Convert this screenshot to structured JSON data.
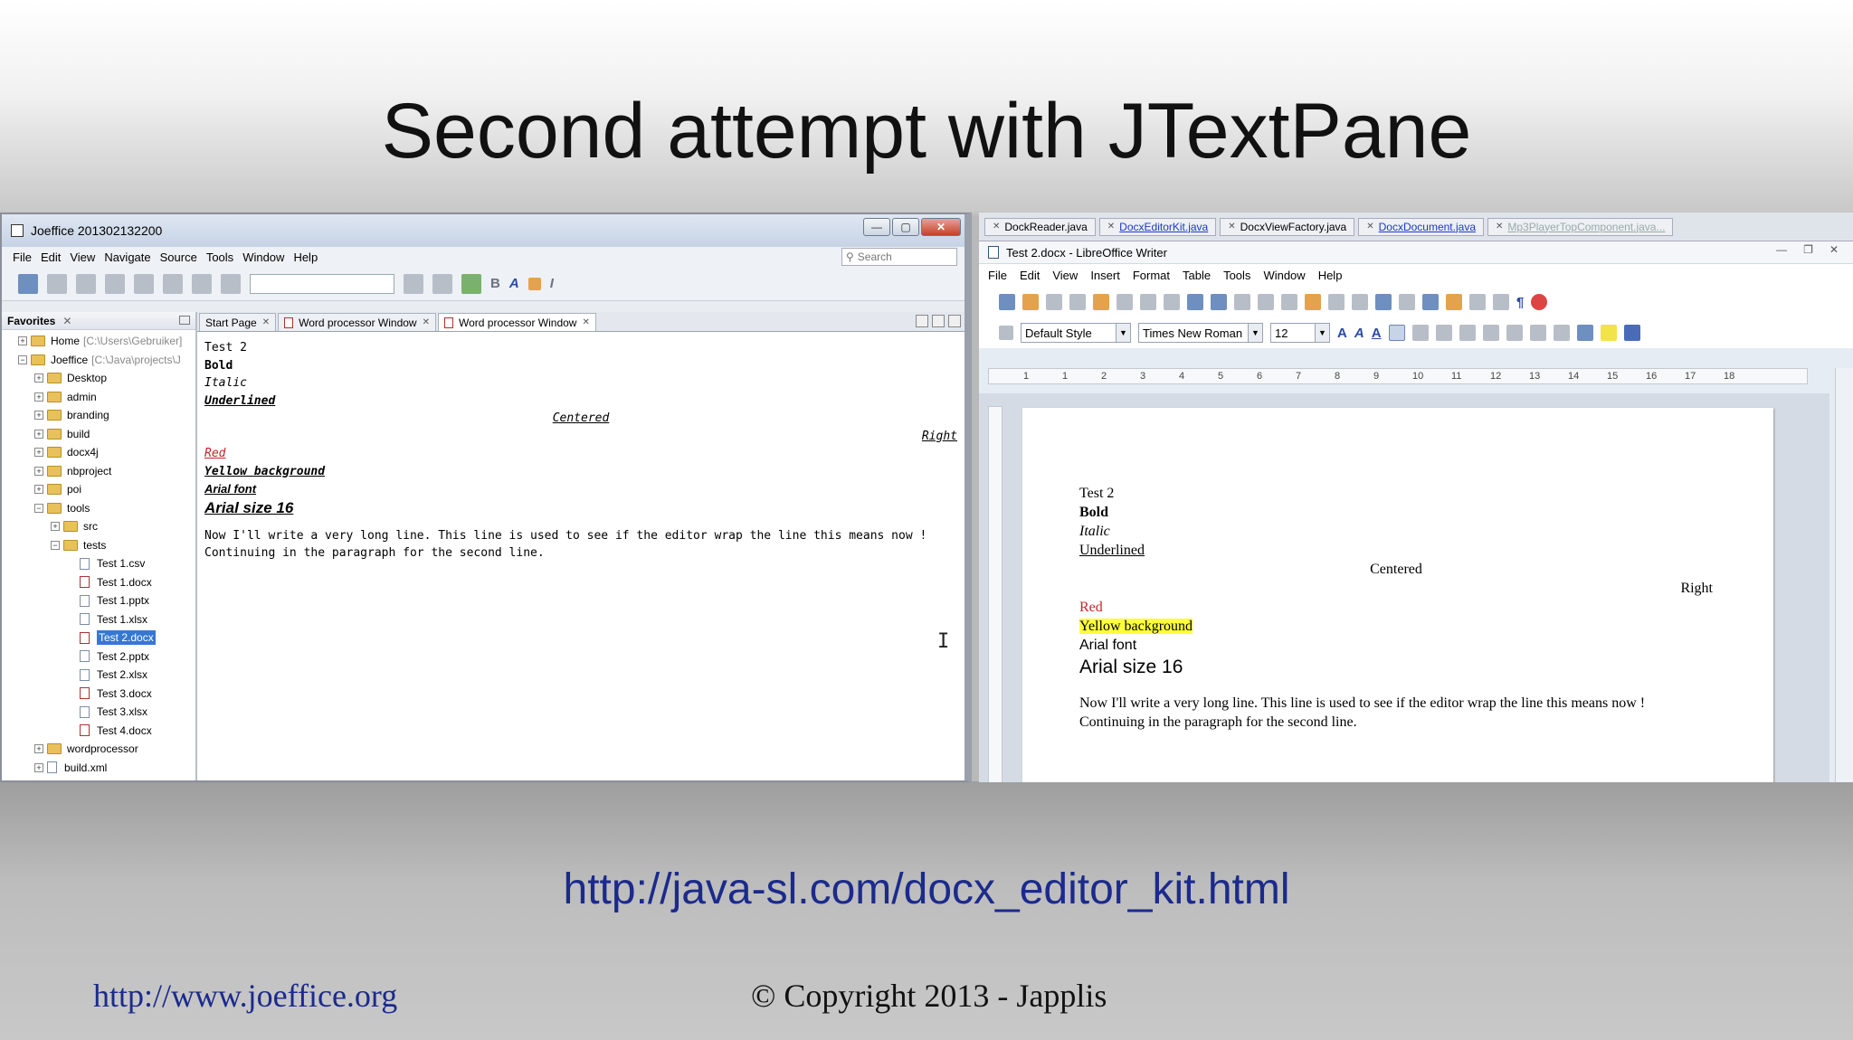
{
  "slide": {
    "title": "Second attempt with JTextPane",
    "url": "http://java-sl.com/docx_editor_kit.html",
    "footer_left": "http://www.joeffice.org",
    "footer_center": "© Copyright 2013 - Japplis"
  },
  "netbeans": {
    "window_title": "Joeffice 201302132200",
    "menu": [
      "File",
      "Edit",
      "View",
      "Navigate",
      "Source",
      "Tools",
      "Window",
      "Help"
    ],
    "search_placeholder": "Search",
    "favorites_title": "Favorites",
    "tree": [
      {
        "label": "Home",
        "muted": "[C:\\Users\\Gebruiker]",
        "depth": 0,
        "type": "folder",
        "exp": "+"
      },
      {
        "label": "Joeffice",
        "muted": "[C:\\Java\\projects\\J",
        "depth": 0,
        "type": "folder",
        "exp": "−"
      },
      {
        "label": "Desktop",
        "depth": 1,
        "type": "folder",
        "exp": "+"
      },
      {
        "label": "admin",
        "depth": 1,
        "type": "folder",
        "exp": "+"
      },
      {
        "label": "branding",
        "depth": 1,
        "type": "folder",
        "exp": "+"
      },
      {
        "label": "build",
        "depth": 1,
        "type": "folder",
        "exp": "+"
      },
      {
        "label": "docx4j",
        "depth": 1,
        "type": "folder",
        "exp": "+"
      },
      {
        "label": "nbproject",
        "depth": 1,
        "type": "folder",
        "exp": "+"
      },
      {
        "label": "poi",
        "depth": 1,
        "type": "folder",
        "exp": "+"
      },
      {
        "label": "tools",
        "depth": 1,
        "type": "folder",
        "exp": "−"
      },
      {
        "label": "src",
        "depth": 2,
        "type": "folder",
        "exp": "+"
      },
      {
        "label": "tests",
        "depth": 2,
        "type": "folder",
        "exp": "−"
      },
      {
        "label": "Test 1.csv",
        "depth": 3,
        "type": "file"
      },
      {
        "label": "Test 1.docx",
        "depth": 3,
        "type": "docx"
      },
      {
        "label": "Test 1.pptx",
        "depth": 3,
        "type": "file"
      },
      {
        "label": "Test 1.xlsx",
        "depth": 3,
        "type": "file"
      },
      {
        "label": "Test 2.docx",
        "depth": 3,
        "type": "docx",
        "selected": true
      },
      {
        "label": "Test 2.pptx",
        "depth": 3,
        "type": "file"
      },
      {
        "label": "Test 2.xlsx",
        "depth": 3,
        "type": "file"
      },
      {
        "label": "Test 3.docx",
        "depth": 3,
        "type": "docx"
      },
      {
        "label": "Test 3.xlsx",
        "depth": 3,
        "type": "file"
      },
      {
        "label": "Test 4.docx",
        "depth": 3,
        "type": "docx"
      },
      {
        "label": "wordprocessor",
        "depth": 1,
        "type": "folder",
        "exp": "+"
      },
      {
        "label": "build.xml",
        "depth": 1,
        "type": "file",
        "exp": "+"
      }
    ],
    "tabs": [
      {
        "label": "Start Page",
        "active": false,
        "doc": false
      },
      {
        "label": "Word processor Window",
        "active": false,
        "doc": true
      },
      {
        "label": "Word processor Window",
        "active": true,
        "doc": true
      }
    ],
    "doc": {
      "line1": "Test 2",
      "line2": "Bold",
      "line3": "Italic",
      "line4": "Underlined",
      "line5": "Centered",
      "line6": "Right",
      "line7": "Red",
      "line8": "Yellow background",
      "line9": "Arial font",
      "line10": "Arial size 16",
      "line11": "Now I'll write a very long line. This line is used to see if the editor wrap the line this means now !",
      "line12": "Continuing in the paragraph for the second line."
    }
  },
  "libreoffice": {
    "ide_tabs": [
      {
        "label": "DockReader.java",
        "style": "normal"
      },
      {
        "label": "DocxEditorKit.java",
        "style": "link"
      },
      {
        "label": "DocxViewFactory.java",
        "style": "normal"
      },
      {
        "label": "DocxDocument.java",
        "style": "link"
      },
      {
        "label": "Mp3PlayerTopComponent.java...",
        "style": "faded"
      }
    ],
    "window_title": "Test 2.docx - LibreOffice Writer",
    "menu": [
      "File",
      "Edit",
      "View",
      "Insert",
      "Format",
      "Table",
      "Tools",
      "Window",
      "Help"
    ],
    "style_combo": "Default Style",
    "font_combo": "Times New Roman",
    "size_combo": "12",
    "ruler_ticks": [
      "1",
      "1",
      "2",
      "3",
      "4",
      "5",
      "6",
      "7",
      "8",
      "9",
      "10",
      "11",
      "12",
      "13",
      "14",
      "15",
      "16",
      "17",
      "18"
    ],
    "doc": {
      "line1": "Test 2",
      "line2": "Bold",
      "line3": "Italic",
      "line4": "Underlined",
      "line5": "Centered",
      "line6": "Right",
      "line7": "Red",
      "line8": "Yellow background",
      "line9": "Arial font",
      "line10": "Arial size 16",
      "line11": "Now I'll write a very long line. This line is used to see if the editor wrap the line this means now !",
      "line12": "Continuing in the paragraph for the second line."
    }
  }
}
